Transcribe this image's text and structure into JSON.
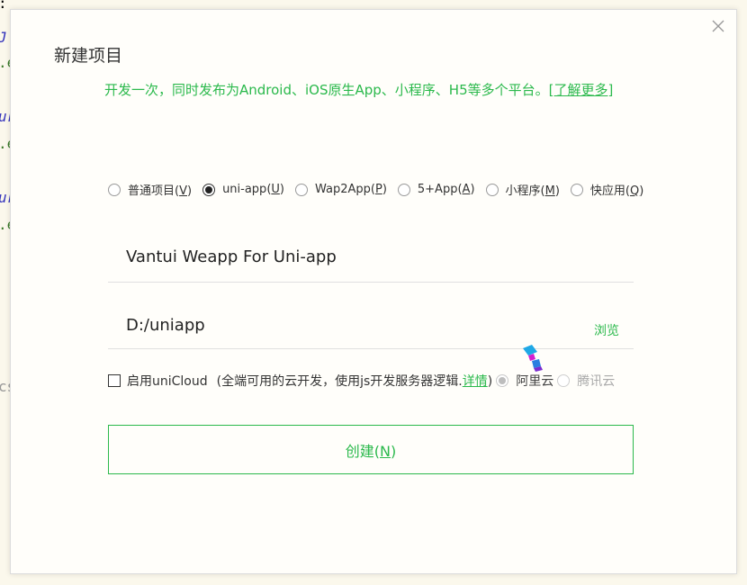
{
  "background": {
    "fragments": [
      {
        "text": ": {",
        "color": "#555555"
      },
      {
        "text": "J",
        "color": "#3333bb"
      },
      {
        "text": ".e",
        "color": "#3a7a2a"
      },
      {
        "text": "ur",
        "color": "#3333bb"
      },
      {
        "text": ".e",
        "color": "#3a7a2a"
      },
      {
        "text": "ur",
        "color": "#3333bb"
      },
      {
        "text": ".e",
        "color": "#3a7a2a"
      },
      {
        "text": "cs",
        "color": "#999999"
      }
    ]
  },
  "dialog": {
    "title": "新建项目",
    "subtitle": "开发一次，同时发布为Android、iOS原生App、小程序、H5等多个平台。",
    "learn_more": "[了解更多]",
    "close_icon": "close-icon"
  },
  "project_types": [
    {
      "label": "普通项目(",
      "key": "V",
      "selected": false
    },
    {
      "label": "uni-app(",
      "key": "U",
      "selected": true
    },
    {
      "label": "Wap2App(",
      "key": "P",
      "selected": false
    },
    {
      "label": "5+App(",
      "key": "A",
      "selected": false
    },
    {
      "label": "小程序(",
      "key": "M",
      "selected": false
    },
    {
      "label": "快应用(",
      "key": "Q",
      "selected": false
    }
  ],
  "project_name": {
    "value": "Vantui Weapp For Uni-app"
  },
  "project_path": {
    "value": "D:/uniapp",
    "browse_label": "浏览"
  },
  "unicloud": {
    "label": "启用uniCloud",
    "desc_prefix": "(全端可用的云开发，使用js开发服务器逻辑.",
    "detail_link": "详情",
    "desc_suffix": ")",
    "providers": [
      {
        "label": "阿里云",
        "selected": true
      },
      {
        "label": "腾讯云",
        "selected": false
      }
    ]
  },
  "create_button": {
    "label_prefix": "创建(",
    "key": "N",
    "label_suffix": ")"
  },
  "colors": {
    "accent": "#2bb94c",
    "cursor_cyan": "#1fa8e6",
    "cursor_magenta": "#d41fd0"
  }
}
